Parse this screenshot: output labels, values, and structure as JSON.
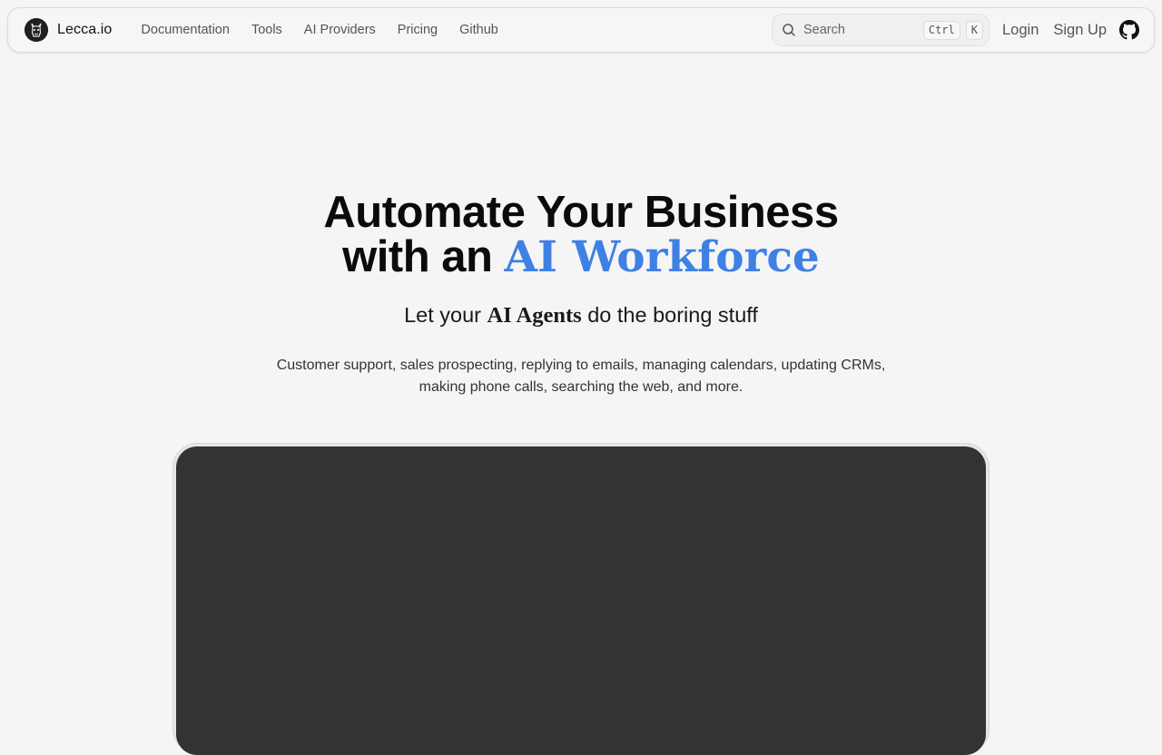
{
  "nav": {
    "brand": "Lecca.io",
    "links": [
      "Documentation",
      "Tools",
      "AI Providers",
      "Pricing",
      "Github"
    ],
    "search": {
      "placeholder": "Search",
      "shortcut_mod": "Ctrl",
      "shortcut_key": "K"
    },
    "login": "Login",
    "signup": "Sign Up"
  },
  "hero": {
    "headline_line1": "Automate Your Business",
    "headline_line2_prefix": "with an ",
    "headline_accent": "AI Workforce",
    "subhead_prefix": "Let your ",
    "subhead_emphasis": "AI Agents",
    "subhead_suffix": " do the boring stuff",
    "description": "Customer support, sales prospecting, replying to emails, managing calendars, updating CRMs, making phone calls, searching the web, and more."
  },
  "colors": {
    "accent": "#3f80e4",
    "video_bg": "#333333",
    "page_bg": "#f5f5f5"
  },
  "icons": {
    "logo": "llama-logo-icon",
    "search": "search-icon",
    "github": "github-icon"
  }
}
